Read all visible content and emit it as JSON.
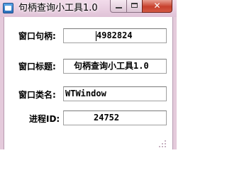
{
  "window": {
    "title": "句柄查询小工具1.0",
    "close_glyph": "✕"
  },
  "fields": {
    "handle": {
      "label": "窗口句柄:",
      "value": "4982824"
    },
    "window_title": {
      "label": "窗口标题:",
      "value": "句柄查询小工具1.0"
    },
    "class_name": {
      "label": "窗口类名:",
      "value": "WTWindow"
    },
    "process_id": {
      "label": "进程ID:",
      "value": "24752"
    }
  }
}
